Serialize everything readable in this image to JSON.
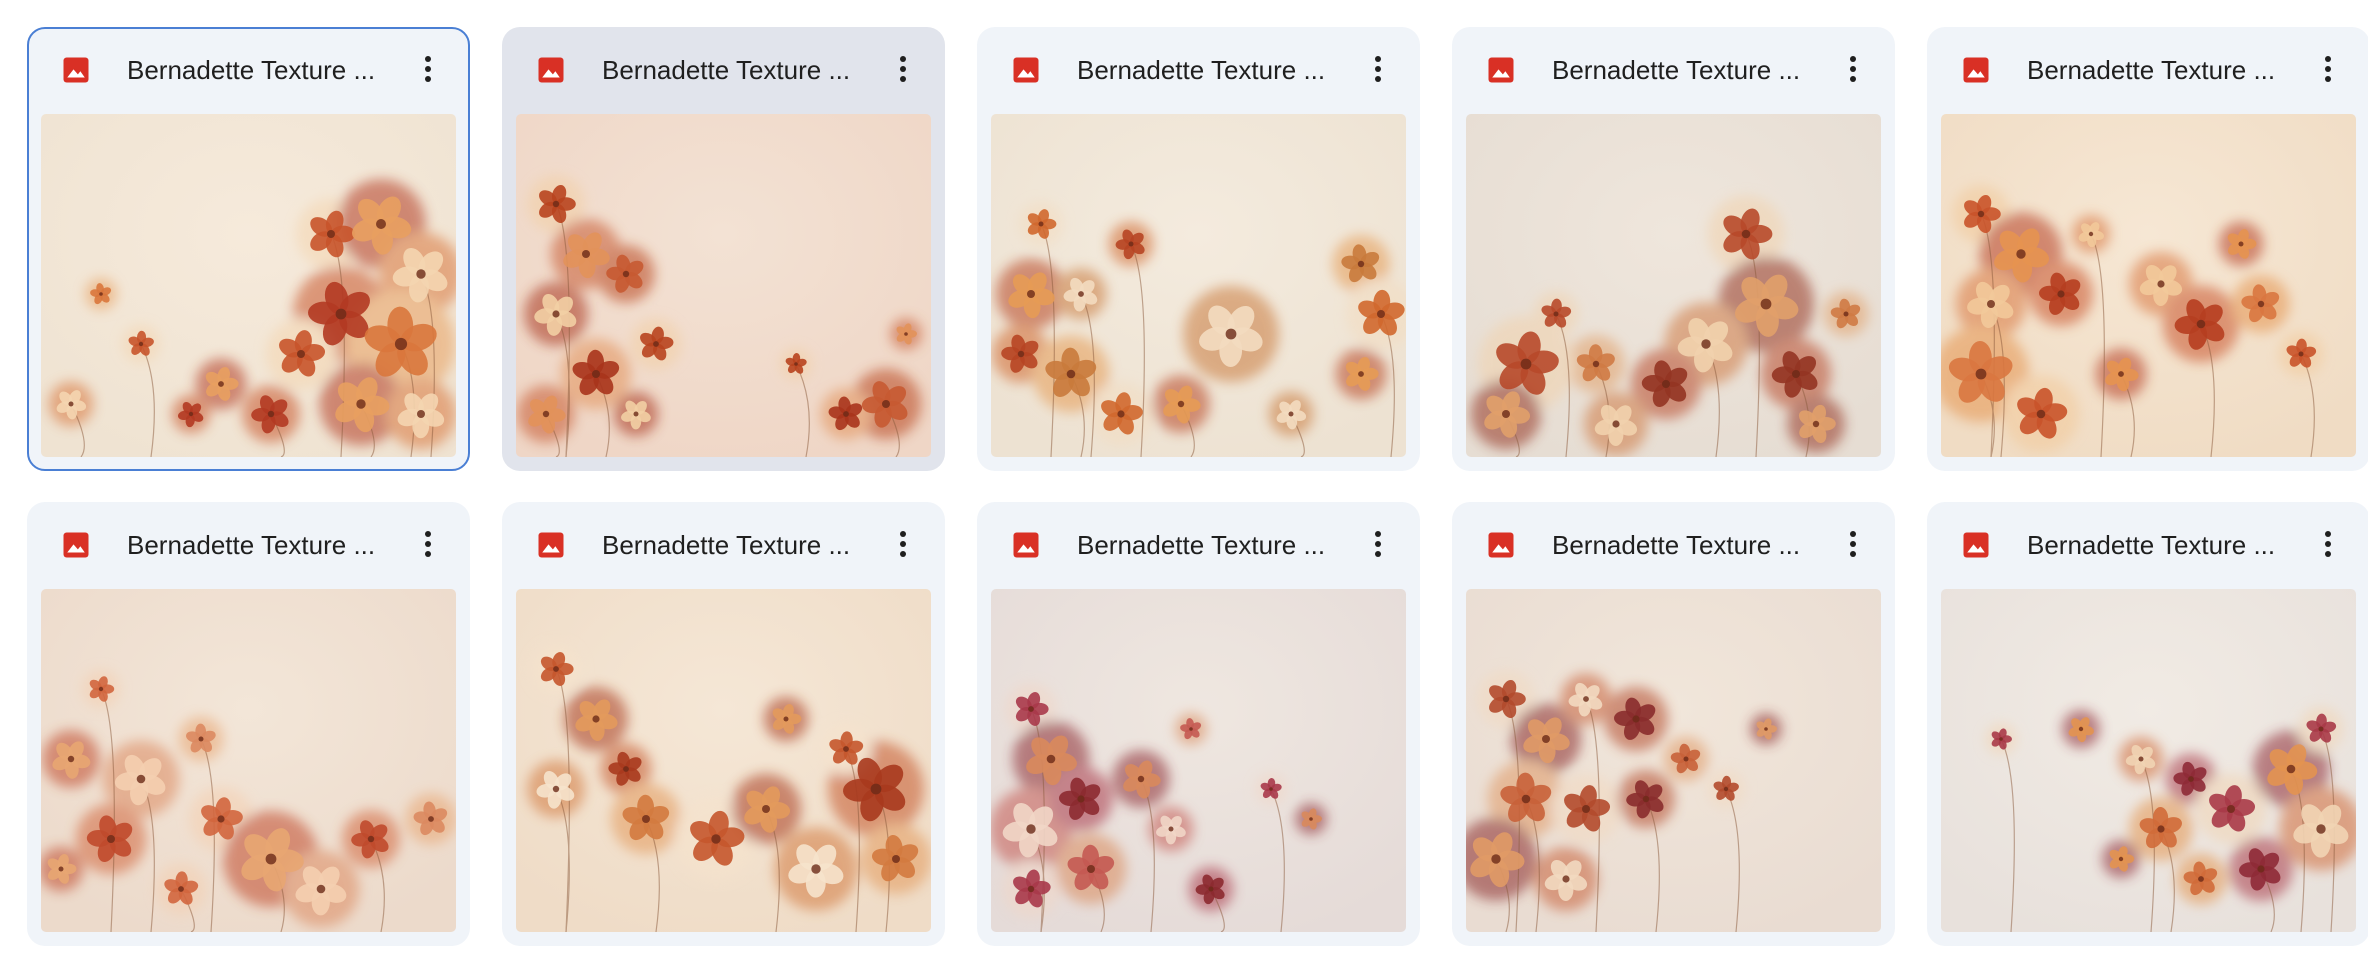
{
  "files": [
    {
      "name": "Bernadette Texture ...",
      "icon": "image-file-icon",
      "state": "selected",
      "bg": "#efe3d2",
      "haze": "#f6eadb",
      "flowers": [
        "#c8542b",
        "#e8a060",
        "#f4d5b0",
        "#b23a22",
        "#d9773c"
      ]
    },
    {
      "name": "Bernadette Texture ...",
      "icon": "image-file-icon",
      "state": "hovered",
      "bg": "#efd6c6",
      "haze": "#f3e2d4",
      "flowers": [
        "#b8441f",
        "#e2925a",
        "#f2cfa4",
        "#c75a32",
        "#a8341c"
      ]
    },
    {
      "name": "Bernadette Texture ...",
      "icon": "image-file-icon",
      "state": "normal",
      "bg": "#ede2d2",
      "haze": "#f4ebde",
      "flowers": [
        "#d0682e",
        "#e59b55",
        "#f3dcc0",
        "#b74524",
        "#c97a3c"
      ]
    },
    {
      "name": "Bernadette Texture ...",
      "icon": "image-file-icon",
      "state": "normal",
      "bg": "#e6ddd3",
      "haze": "#efe6dc",
      "flowers": [
        "#b7492a",
        "#e1a06a",
        "#f1d2ad",
        "#943422",
        "#cf7a45"
      ]
    },
    {
      "name": "Bernadette Texture ...",
      "icon": "image-file-icon",
      "state": "normal",
      "bg": "#f0dcc4",
      "haze": "#f6e7d4",
      "flowers": [
        "#c9532a",
        "#e59450",
        "#f2c99a",
        "#b63e20",
        "#d97740"
      ]
    },
    {
      "name": "Bernadette Texture ...",
      "icon": "image-file-icon",
      "state": "normal",
      "bg": "#ecdacb",
      "haze": "#f3e6d8",
      "flowers": [
        "#d1663e",
        "#e8a672",
        "#f4cfb0",
        "#c04a2c",
        "#dc8a60"
      ]
    },
    {
      "name": "Bernadette Texture ...",
      "icon": "image-file-icon",
      "state": "normal",
      "bg": "#efdcc7",
      "haze": "#f5e7d6",
      "flowers": [
        "#c5572c",
        "#e39a5c",
        "#f6e3cc",
        "#a83a1e",
        "#d37a3f"
      ]
    },
    {
      "name": "Bernadette Texture ...",
      "icon": "image-file-icon",
      "state": "normal",
      "bg": "#e5dbd8",
      "haze": "#efe7e0",
      "flowers": [
        "#a8394a",
        "#d98a5c",
        "#f1d6c6",
        "#8c2a30",
        "#c45a52"
      ]
    },
    {
      "name": "Bernadette Texture ...",
      "icon": "image-file-icon",
      "state": "normal",
      "bg": "#e9dcd2",
      "haze": "#f1e6da",
      "flowers": [
        "#b24a2c",
        "#e09a66",
        "#f2d9c0",
        "#8a2c2c",
        "#c8623a"
      ]
    },
    {
      "name": "Bernadette Texture ...",
      "icon": "image-file-icon",
      "state": "normal",
      "bg": "#e8e1dc",
      "haze": "#f1ebe4",
      "flowers": [
        "#a83a48",
        "#e39450",
        "#f1d4b4",
        "#8e2a36",
        "#d06c3a"
      ]
    }
  ],
  "colors": {
    "card_bg": "#f0f4f9",
    "card_hover_bg": "#e1e4ec",
    "selected_border": "#4a7fd4",
    "image_icon": "#d93025",
    "text": "#1f1f1f"
  }
}
